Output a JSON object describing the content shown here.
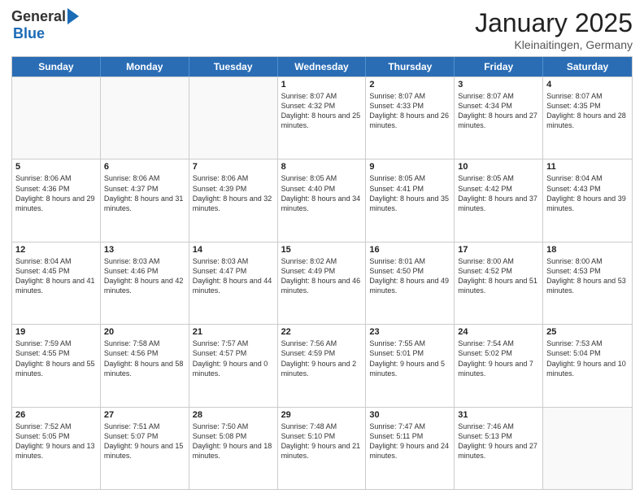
{
  "logo": {
    "general": "General",
    "blue": "Blue"
  },
  "title": "January 2025",
  "location": "Kleinaitingen, Germany",
  "header_days": [
    "Sunday",
    "Monday",
    "Tuesday",
    "Wednesday",
    "Thursday",
    "Friday",
    "Saturday"
  ],
  "rows": [
    [
      {
        "day": "",
        "info": ""
      },
      {
        "day": "",
        "info": ""
      },
      {
        "day": "",
        "info": ""
      },
      {
        "day": "1",
        "info": "Sunrise: 8:07 AM\nSunset: 4:32 PM\nDaylight: 8 hours\nand 25 minutes."
      },
      {
        "day": "2",
        "info": "Sunrise: 8:07 AM\nSunset: 4:33 PM\nDaylight: 8 hours\nand 26 minutes."
      },
      {
        "day": "3",
        "info": "Sunrise: 8:07 AM\nSunset: 4:34 PM\nDaylight: 8 hours\nand 27 minutes."
      },
      {
        "day": "4",
        "info": "Sunrise: 8:07 AM\nSunset: 4:35 PM\nDaylight: 8 hours\nand 28 minutes."
      }
    ],
    [
      {
        "day": "5",
        "info": "Sunrise: 8:06 AM\nSunset: 4:36 PM\nDaylight: 8 hours\nand 29 minutes."
      },
      {
        "day": "6",
        "info": "Sunrise: 8:06 AM\nSunset: 4:37 PM\nDaylight: 8 hours\nand 31 minutes."
      },
      {
        "day": "7",
        "info": "Sunrise: 8:06 AM\nSunset: 4:39 PM\nDaylight: 8 hours\nand 32 minutes."
      },
      {
        "day": "8",
        "info": "Sunrise: 8:05 AM\nSunset: 4:40 PM\nDaylight: 8 hours\nand 34 minutes."
      },
      {
        "day": "9",
        "info": "Sunrise: 8:05 AM\nSunset: 4:41 PM\nDaylight: 8 hours\nand 35 minutes."
      },
      {
        "day": "10",
        "info": "Sunrise: 8:05 AM\nSunset: 4:42 PM\nDaylight: 8 hours\nand 37 minutes."
      },
      {
        "day": "11",
        "info": "Sunrise: 8:04 AM\nSunset: 4:43 PM\nDaylight: 8 hours\nand 39 minutes."
      }
    ],
    [
      {
        "day": "12",
        "info": "Sunrise: 8:04 AM\nSunset: 4:45 PM\nDaylight: 8 hours\nand 41 minutes."
      },
      {
        "day": "13",
        "info": "Sunrise: 8:03 AM\nSunset: 4:46 PM\nDaylight: 8 hours\nand 42 minutes."
      },
      {
        "day": "14",
        "info": "Sunrise: 8:03 AM\nSunset: 4:47 PM\nDaylight: 8 hours\nand 44 minutes."
      },
      {
        "day": "15",
        "info": "Sunrise: 8:02 AM\nSunset: 4:49 PM\nDaylight: 8 hours\nand 46 minutes."
      },
      {
        "day": "16",
        "info": "Sunrise: 8:01 AM\nSunset: 4:50 PM\nDaylight: 8 hours\nand 49 minutes."
      },
      {
        "day": "17",
        "info": "Sunrise: 8:00 AM\nSunset: 4:52 PM\nDaylight: 8 hours\nand 51 minutes."
      },
      {
        "day": "18",
        "info": "Sunrise: 8:00 AM\nSunset: 4:53 PM\nDaylight: 8 hours\nand 53 minutes."
      }
    ],
    [
      {
        "day": "19",
        "info": "Sunrise: 7:59 AM\nSunset: 4:55 PM\nDaylight: 8 hours\nand 55 minutes."
      },
      {
        "day": "20",
        "info": "Sunrise: 7:58 AM\nSunset: 4:56 PM\nDaylight: 8 hours\nand 58 minutes."
      },
      {
        "day": "21",
        "info": "Sunrise: 7:57 AM\nSunset: 4:57 PM\nDaylight: 9 hours\nand 0 minutes."
      },
      {
        "day": "22",
        "info": "Sunrise: 7:56 AM\nSunset: 4:59 PM\nDaylight: 9 hours\nand 2 minutes."
      },
      {
        "day": "23",
        "info": "Sunrise: 7:55 AM\nSunset: 5:01 PM\nDaylight: 9 hours\nand 5 minutes."
      },
      {
        "day": "24",
        "info": "Sunrise: 7:54 AM\nSunset: 5:02 PM\nDaylight: 9 hours\nand 7 minutes."
      },
      {
        "day": "25",
        "info": "Sunrise: 7:53 AM\nSunset: 5:04 PM\nDaylight: 9 hours\nand 10 minutes."
      }
    ],
    [
      {
        "day": "26",
        "info": "Sunrise: 7:52 AM\nSunset: 5:05 PM\nDaylight: 9 hours\nand 13 minutes."
      },
      {
        "day": "27",
        "info": "Sunrise: 7:51 AM\nSunset: 5:07 PM\nDaylight: 9 hours\nand 15 minutes."
      },
      {
        "day": "28",
        "info": "Sunrise: 7:50 AM\nSunset: 5:08 PM\nDaylight: 9 hours\nand 18 minutes."
      },
      {
        "day": "29",
        "info": "Sunrise: 7:48 AM\nSunset: 5:10 PM\nDaylight: 9 hours\nand 21 minutes."
      },
      {
        "day": "30",
        "info": "Sunrise: 7:47 AM\nSunset: 5:11 PM\nDaylight: 9 hours\nand 24 minutes."
      },
      {
        "day": "31",
        "info": "Sunrise: 7:46 AM\nSunset: 5:13 PM\nDaylight: 9 hours\nand 27 minutes."
      },
      {
        "day": "",
        "info": ""
      }
    ]
  ]
}
